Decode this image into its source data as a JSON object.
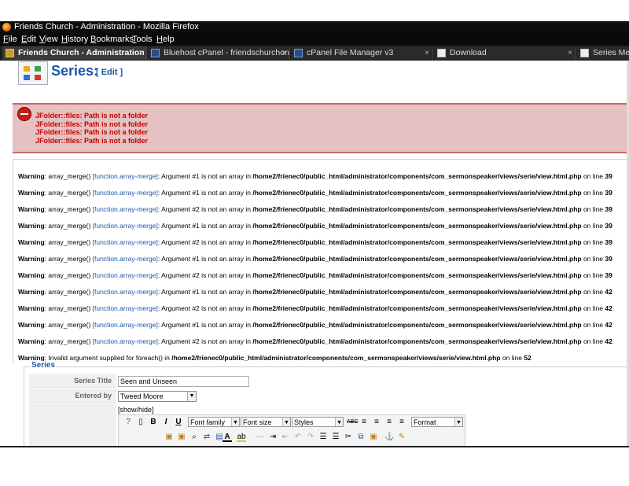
{
  "window": {
    "title": "Friends Church - Administration - Mozilla Firefox"
  },
  "menu": [
    "File",
    "Edit",
    "View",
    "History",
    "Bookmarks",
    "Tools",
    "Help"
  ],
  "tabs": [
    {
      "label": "Friends Church - Administration",
      "close": "×",
      "active": true,
      "icon": "joomla-icon"
    },
    {
      "label": "Bluehost cPanel - friendschurchon...",
      "close": "×",
      "active": false,
      "icon": "cpanel-icon"
    },
    {
      "label": "cPanel File Manager v3",
      "close": "×",
      "active": false,
      "icon": "cpanel-icon"
    },
    {
      "label": "Download",
      "close": "×",
      "active": false,
      "icon": "document-icon"
    },
    {
      "label": "Series Menu",
      "close": "",
      "active": false,
      "icon": "document-icon"
    }
  ],
  "header": {
    "title": "Series:",
    "edit_label": "[ Edit ]"
  },
  "errors": [
    "JFolder::files: Path is not a folder",
    "JFolder::files: Path is not a folder",
    "JFolder::files: Path is not a folder",
    "JFolder::files: Path is not a folder"
  ],
  "warnings": [
    {
      "label": "Warning",
      "func": "array_merge()",
      "link": "[function.array-merge]",
      "arg": "#1",
      "line": "39"
    },
    {
      "label": "Warning",
      "func": "array_merge()",
      "link": "[function.array-merge]",
      "arg": "#1",
      "line": "39"
    },
    {
      "label": "Warning",
      "func": "array_merge()",
      "link": "[function.array-merge]",
      "arg": "#2",
      "line": "39"
    },
    {
      "label": "Warning",
      "func": "array_merge()",
      "link": "[function.array-merge]",
      "arg": "#1",
      "line": "39"
    },
    {
      "label": "Warning",
      "func": "array_merge()",
      "link": "[function.array-merge]",
      "arg": "#2",
      "line": "39"
    },
    {
      "label": "Warning",
      "func": "array_merge()",
      "link": "[function.array-merge]",
      "arg": "#1",
      "line": "39"
    },
    {
      "label": "Warning",
      "func": "array_merge()",
      "link": "[function.array-merge]",
      "arg": "#2",
      "line": "39"
    },
    {
      "label": "Warning",
      "func": "array_merge()",
      "link": "[function.array-merge]",
      "arg": "#1",
      "line": "42"
    },
    {
      "label": "Warning",
      "func": "array_merge()",
      "link": "[function.array-merge]",
      "arg": "#2",
      "line": "42"
    },
    {
      "label": "Warning",
      "func": "array_merge()",
      "link": "[function.array-merge]",
      "arg": "#1",
      "line": "42"
    },
    {
      "label": "Warning",
      "func": "array_merge()",
      "link": "[function.array-merge]",
      "arg": "#2",
      "line": "42"
    }
  ],
  "warning_path": "/home2/frienec0/public_html/administrator/components/com_sermonspeaker/views/serie/view.html.php",
  "warning_text": {
    "argument": "Argument",
    "is_not_array": "is not an array in",
    "on_line": "on line"
  },
  "foreach_warning": {
    "label": "Warning",
    "text": ": Invalid argument supplied for foreach() in",
    "path": "/home2/frienec0/public_html/administrator/components/com_sermonspeaker/views/serie/view.html.php",
    "on_line": "on line",
    "line": "52"
  },
  "form": {
    "legend": "Series",
    "title_label": "Series Title",
    "title_value": "Seen and Unseen",
    "entered_by_label": "Entered by",
    "entered_by_value": "Tweed Moore",
    "show_hide": "[show/hide]"
  },
  "editor": {
    "font_family": "Font family",
    "font_size": "Font size",
    "styles": "Styles",
    "format": "Format"
  },
  "colors": {
    "title_blue": "#1a56a8",
    "error_red": "#c40000",
    "error_bg": "#e6c1c1"
  }
}
